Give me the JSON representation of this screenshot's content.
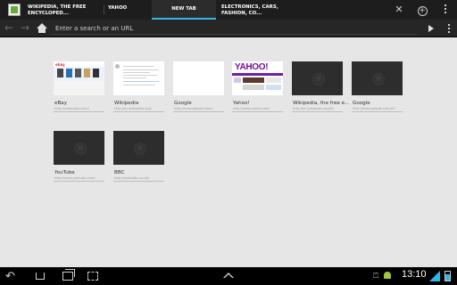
{
  "tabs": [
    {
      "label": "WIKIPEDIA, THE FREE ENCYCLOPED...",
      "icon": "wikipedia-favicon-icon",
      "active": false
    },
    {
      "label": "YAHOO",
      "active": false
    },
    {
      "label": "NEW TAB",
      "active": true
    },
    {
      "label": "ELECTRONICS, CARS, FASHION, CO...",
      "active": false
    }
  ],
  "toolbar": {
    "close_label": "✕",
    "new_tab_label": "+"
  },
  "urlbar": {
    "placeholder": "Enter a search or an URL",
    "value": ""
  },
  "thumbnails": [
    {
      "title": "eBay",
      "url": "http://www.ebay.com/",
      "kind": "ebay"
    },
    {
      "title": "Wikipedia",
      "url": "http://en.wikipedia.org/",
      "kind": "wikipedia"
    },
    {
      "title": "Google",
      "url": "http://www.google.com/",
      "kind": "white"
    },
    {
      "title": "Yahoo!",
      "url": "http://www.yahoo.com/",
      "kind": "yahoo",
      "logo_text": "YAHOO!"
    },
    {
      "title": "Wikipedia, the free e...",
      "url": "http://en.wikipedia.org/wi",
      "kind": "empty"
    },
    {
      "title": "Google",
      "url": "http://www.google.com/m/",
      "kind": "empty"
    },
    {
      "title": "YouTube",
      "url": "http://www.youtube.com/",
      "kind": "empty"
    },
    {
      "title": "BBC",
      "url": "http://www.bbc.co.uk/",
      "kind": "empty"
    }
  ],
  "ebay": {
    "logo_text": "ebay"
  },
  "system": {
    "clock": "13:10",
    "accent": "#33b5e5"
  }
}
